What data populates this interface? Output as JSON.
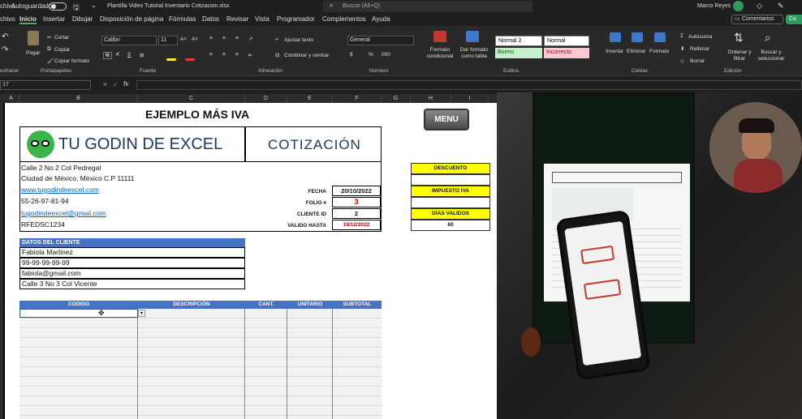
{
  "titlebar": {
    "app_label": "chivo",
    "autosave_label": "Autoguardado",
    "file_name": "Plantilla Video Tutorial Inventario Cotizacion.xlsx",
    "search_placeholder": "Buscar (Alt+Q)",
    "user_name": "Marco Reyes"
  },
  "tabs": [
    "Inicio",
    "Insertar",
    "Dibujar",
    "Disposición de página",
    "Fórmulas",
    "Datos",
    "Revisar",
    "Vista",
    "Programador",
    "Complementos",
    "Ayuda"
  ],
  "comments_button": "Comentarios",
  "share_button": "Co",
  "ribbon": {
    "cut": "Cortar",
    "copy": "Copiar",
    "format_painter": "Copiar formato",
    "paste": "Pegar",
    "undo_group": "eshacer",
    "clipboard_group": "Portapapeles",
    "font_name": "Calibri",
    "font_size": "11",
    "font_group": "Fuente",
    "wrap_text": "Ajustar texto",
    "merge": "Combinar y centrar",
    "alignment_group": "Alineación",
    "number_format": "General",
    "number_group": "Número",
    "cond_format": "Formato condicional",
    "format_table": "Dar formato como tabla",
    "styles_group": "Estilos",
    "style_normal2": "Normal 2",
    "style_normal": "Normal",
    "style_bueno": "Bueno",
    "style_incorrecto": "Incorrecto",
    "insert": "Insertar",
    "delete": "Eliminar",
    "format": "Formato",
    "cells_group": "Celdas",
    "autosum": "Autosuma",
    "fill": "Rellenar",
    "clear": "Borrar",
    "sort_filter": "Ordenar y filtrar",
    "find_select": "Buscar y seleccionar",
    "editing_group": "Edición"
  },
  "formula_bar": {
    "name_box": "17",
    "fx": "fx",
    "content": ""
  },
  "columns": [
    "A",
    "B",
    "C",
    "D",
    "E",
    "F",
    "G",
    "H",
    "I"
  ],
  "sheet": {
    "title": "EJEMPLO MÁS IVA",
    "menu_button": "MENU",
    "company": "TU GODIN DE EXCEL",
    "doc_type": "COTIZACIÓN",
    "address1": "Calle 2 No 2 Col Pedregal",
    "address2": "Ciudad de México, México C.P 11111",
    "website": "www.tugodindeexcel.com",
    "phone": "55-26-97-81-94",
    "email": "tugodindeexcel@gmail.com",
    "rfc": "RFEDSC1234",
    "fecha_label": "FECHA",
    "fecha_value": "20/10/2022",
    "folio_label": "FOLIO #",
    "folio_value": "3",
    "cliente_label": "CLIENTE ID",
    "cliente_value": "2",
    "valido_label": "VALIDO HASTA",
    "valido_value": "19/12/2022",
    "descuento_label": "DESCUENTO",
    "descuento_value": "",
    "iva_label": "IMPUESTO IVA",
    "iva_value": "",
    "dias_label": "DÍAS VALIDOS",
    "dias_value": "60",
    "client_header": "DATOS DEL CLIENTE",
    "client_name": "Fabiola Martinez",
    "client_phone": "99-99-99-99-99",
    "client_email": "fabiola@gmail.com",
    "client_address": "Calle 3 No 3 Col Vicente",
    "table_headers": [
      "CODIGO",
      "DESCRIPCIÓN",
      "CANT.",
      "UNITARIO",
      "SUBTOTAL"
    ]
  },
  "colors": {
    "accent_blue": "#4472c4",
    "yellow": "#ffff00",
    "red": "#c00000",
    "link": "#0563c1"
  }
}
